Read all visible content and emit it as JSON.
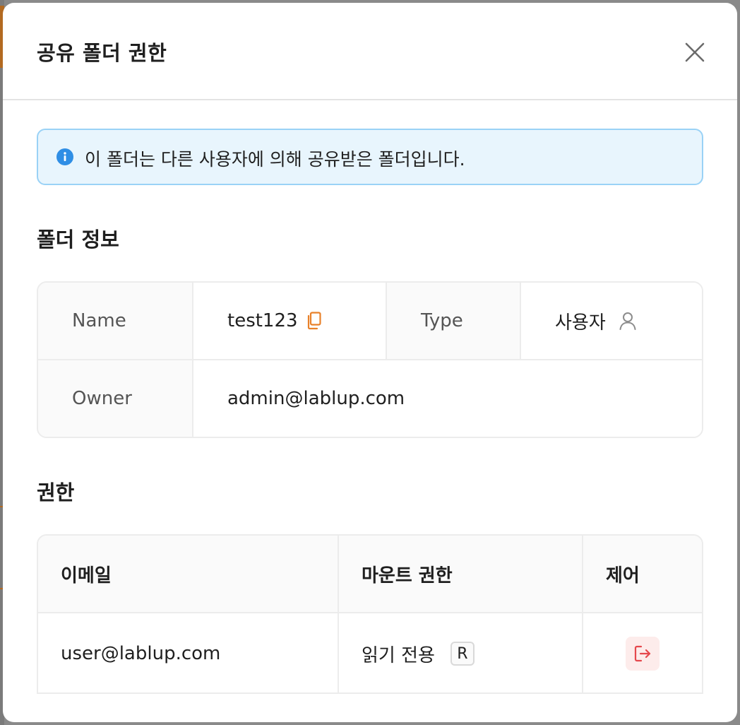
{
  "modal": {
    "title": "공유 폴더 권한",
    "close_icon": "close-icon"
  },
  "alert": {
    "icon": "info-icon",
    "text": "이 폴더는 다른 사용자에 의해 공유받은 폴더입니다."
  },
  "folder_info": {
    "section_title": "폴더 정보",
    "name_label": "Name",
    "name_value": "test123",
    "type_label": "Type",
    "type_value": "사용자",
    "owner_label": "Owner",
    "owner_value": "admin@lablup.com"
  },
  "permissions": {
    "section_title": "권한",
    "columns": [
      "이메일",
      "마운트 권한",
      "제어"
    ],
    "rows": [
      {
        "email": "user@lablup.com",
        "permission": "읽기 전용",
        "permission_tag": "R",
        "control_icon": "leave-icon"
      }
    ]
  },
  "colors": {
    "accent_orange": "#e8812a",
    "info_blue": "#2f8ee5",
    "danger_red": "#e5484d",
    "alert_bg": "#e8f5fd"
  }
}
